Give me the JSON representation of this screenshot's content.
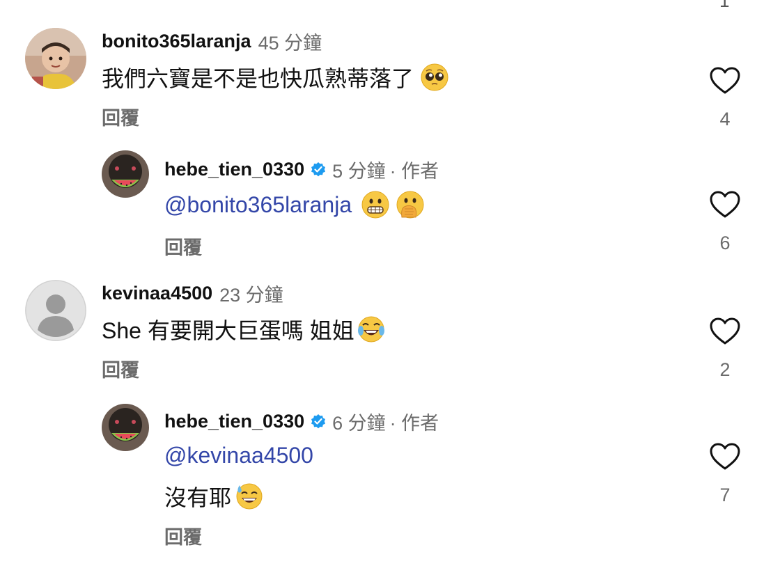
{
  "top_partial_count": "1",
  "comments": [
    {
      "username": "bonito365laranja",
      "time": "45 分鐘",
      "author_tag": "",
      "text": "我們六寶是不是也快瓜熟蒂落了",
      "emoji": "pleading-face-emoji",
      "reply_label": "回覆",
      "likes": "4"
    },
    {
      "username": "hebe_tien_0330",
      "time": "5 分鐘",
      "author_tag": " · 作者",
      "mention": "@bonito365laranja",
      "emoji": [
        "grimacing-face-emoji",
        "face-with-hand-over-mouth-emoji"
      ],
      "reply_label": "回覆",
      "likes": "6"
    },
    {
      "username": "kevinaa4500",
      "time": "23 分鐘",
      "author_tag": "",
      "text": "She 有要開大巨蛋嗎 姐姐",
      "emoji": "tears-of-joy-emoji",
      "reply_label": "回覆",
      "likes": "2"
    },
    {
      "username": "hebe_tien_0330",
      "time": "6 分鐘",
      "author_tag": " · 作者",
      "mention": "@kevinaa4500",
      "text": "沒有耶",
      "emoji": "grinning-sweat-emoji",
      "reply_label": "回覆",
      "likes": "7"
    }
  ],
  "colors": {
    "mention": "#3346a8",
    "verified": "#1d9bf0",
    "secondary_text": "#6b6b6b"
  }
}
